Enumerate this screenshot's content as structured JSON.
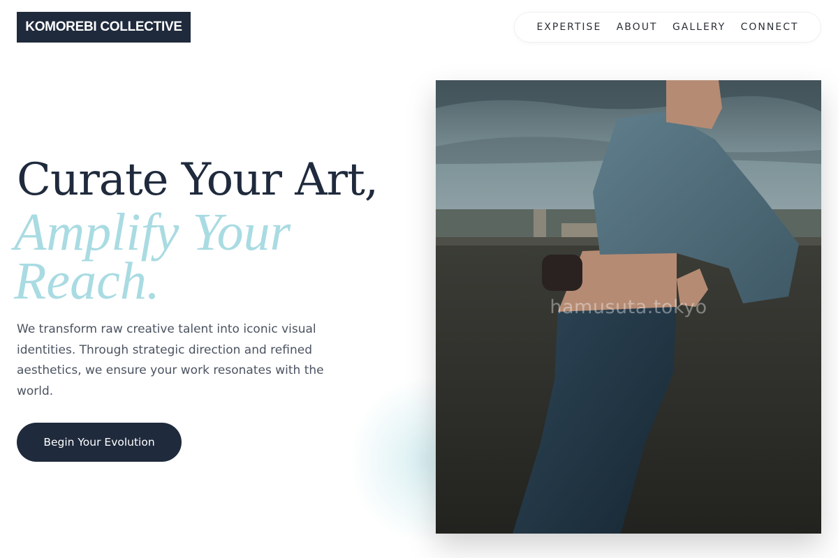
{
  "header": {
    "logo_text": "KOMOREBI COLLECTIVE",
    "nav": [
      {
        "label": "EXPERTISE"
      },
      {
        "label": "ABOUT"
      },
      {
        "label": "GALLERY"
      },
      {
        "label": "CONNECT"
      }
    ]
  },
  "hero": {
    "headline_line1": "Curate Your Art,",
    "headline_accent": "Amplify Your Reach.",
    "description": "We transform raw creative talent into iconic visual identities. Through strategic direction and refined aesthetics, we ensure your work resonates with the world.",
    "cta_label": "Begin Your Evolution",
    "image_watermark": "hamusuta.tokyo"
  },
  "colors": {
    "primary": "#1f2a3c",
    "accent": "#a9dbe2",
    "body_text": "#4b5360"
  }
}
